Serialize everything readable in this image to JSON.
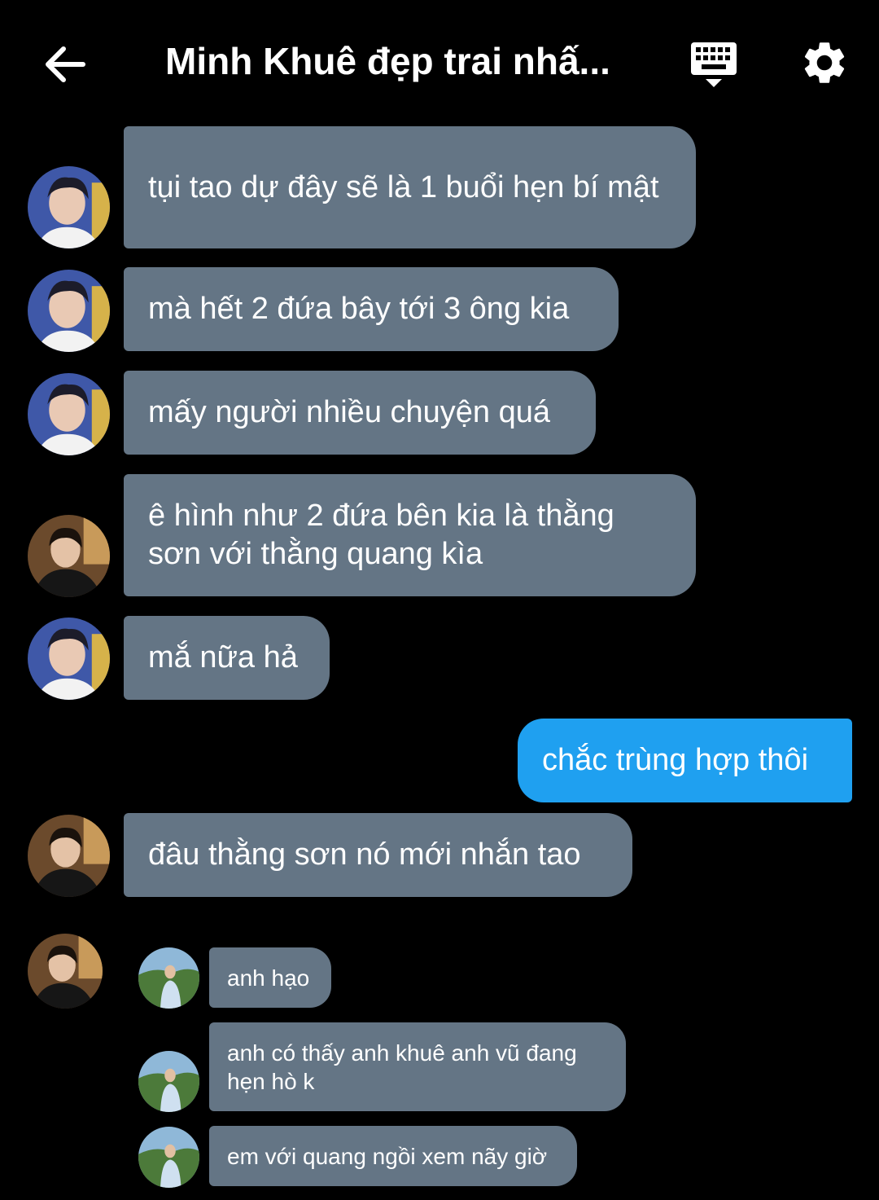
{
  "header": {
    "title": "Minh Khuê đẹp trai nhấ...",
    "back_icon": "arrow-left-icon",
    "keyboard_icon": "keyboard-icon",
    "settings_icon": "gear-icon"
  },
  "colors": {
    "incoming_bubble": "#647585",
    "outgoing_bubble": "#1fa0f0",
    "background": "#000000"
  },
  "messages": [
    {
      "sender": "avatar-a",
      "text": "tụi tao dự đây sẽ là 1 buổi hẹn bí mật"
    },
    {
      "sender": "avatar-a",
      "text": "mà hết 2 đứa bây tới 3 ông kia"
    },
    {
      "sender": "avatar-a",
      "text": "mấy người nhiều chuyện quá"
    },
    {
      "sender": "avatar-b",
      "text": "ê hình như 2 đứa bên kia là thằng sơn với thằng quang kìa"
    },
    {
      "sender": "avatar-a",
      "text": "mắ nữa hả"
    },
    {
      "sender": "me",
      "text": "chắc trùng hợp thôi"
    },
    {
      "sender": "avatar-b",
      "text": "đâu thằng sơn nó mới nhắn tao"
    }
  ],
  "embedded_screenshot": [
    {
      "text": "anh hạo"
    },
    {
      "text": "anh có thấy anh khuê anh vũ đang hẹn hò k"
    },
    {
      "text": "em với quang ngồi xem nãy giờ"
    }
  ]
}
